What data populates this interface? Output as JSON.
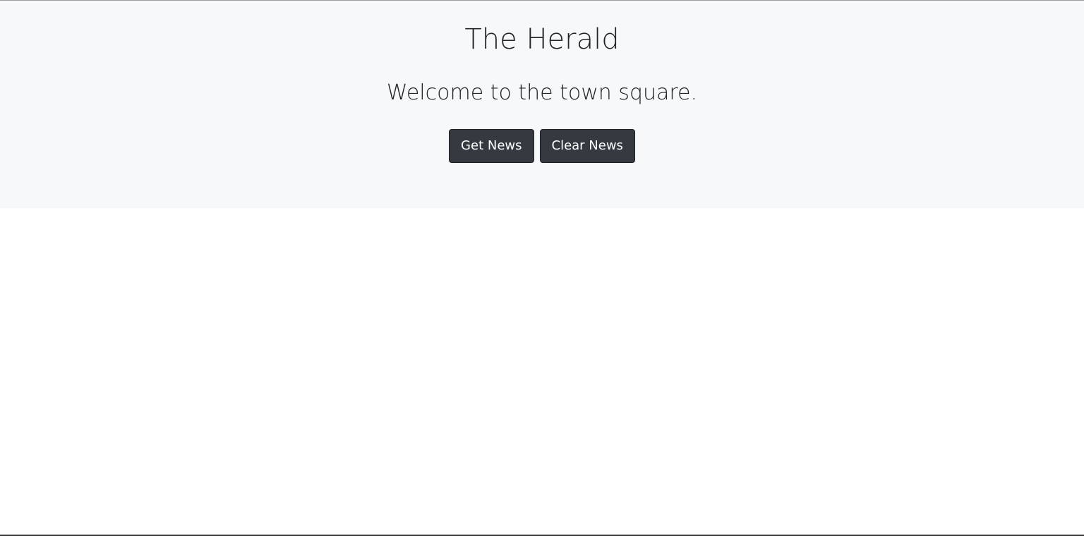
{
  "header": {
    "title": "The Herald",
    "tagline": "Welcome to the town square."
  },
  "actions": {
    "get_news_label": "Get News",
    "clear_news_label": "Clear News"
  },
  "colors": {
    "jumbotron_bg": "#f7f8fa",
    "button_bg": "#343a40",
    "text": "#212529"
  }
}
